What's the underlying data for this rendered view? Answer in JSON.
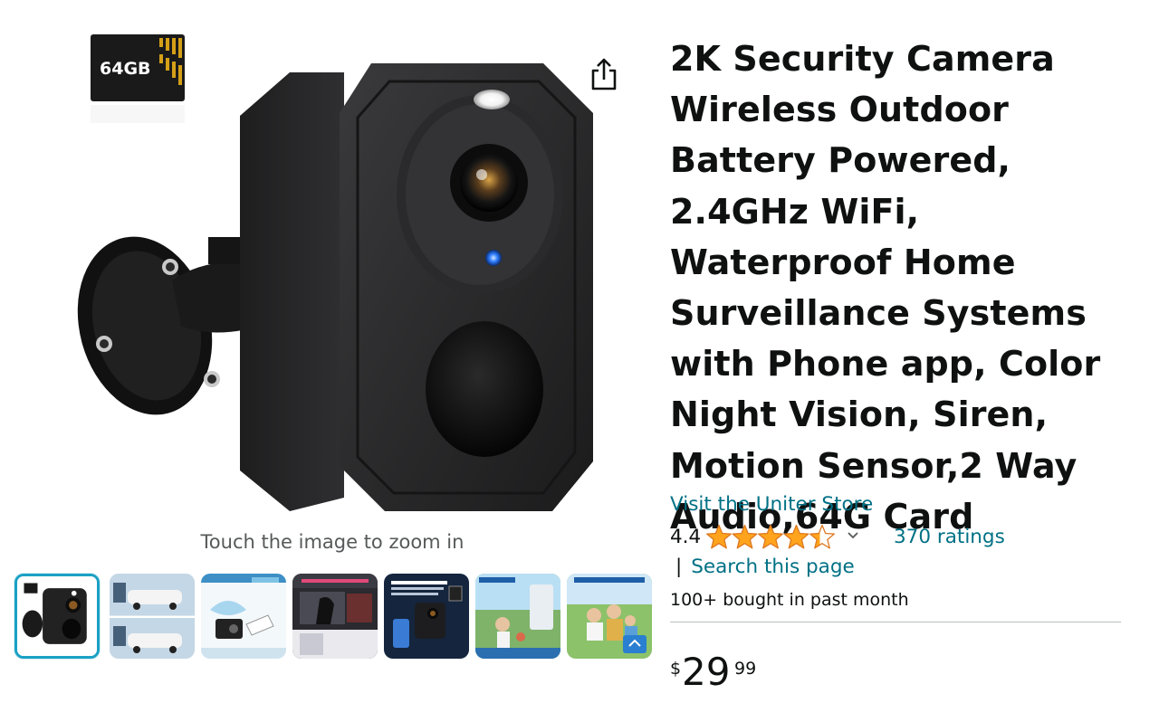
{
  "product": {
    "title": "2K Security Camera Wireless Outdoor Battery Powered, 2.4GHz WiFi, Waterproof Home Surveillance Systems with Phone app, Color Night Vision, Siren, Motion Sensor,2 Way Audio,64G Card",
    "store_link": "Visit the Uniter Store",
    "rating_value": "4.4",
    "rating_stars": 4.4,
    "ratings_count": "370 ratings",
    "search_page": "Search this page",
    "pipe": "|",
    "bought_text": "100+ bought in past month",
    "price": {
      "symbol": "$",
      "whole": "29",
      "fraction": "99"
    }
  },
  "gallery": {
    "zoom_hint": "Touch the image to zoom in",
    "sd_card_label": "64GB",
    "selected_index": 0,
    "thumbnails": [
      {
        "name": "thumb-camera-main"
      },
      {
        "name": "thumb-cars-driveway"
      },
      {
        "name": "thumb-waterproof"
      },
      {
        "name": "thumb-night-vision"
      },
      {
        "name": "thumb-sd-card-storage"
      },
      {
        "name": "thumb-two-way-audio"
      },
      {
        "name": "thumb-family-sharing"
      }
    ]
  },
  "colors": {
    "link": "#007185",
    "star": "#ffa41c",
    "selected_border": "#1ba0c4",
    "text": "#0f1111",
    "muted": "#565959"
  },
  "icons": {
    "share": "share-icon",
    "chevron": "chevron-down-icon",
    "star": "star-icon"
  }
}
